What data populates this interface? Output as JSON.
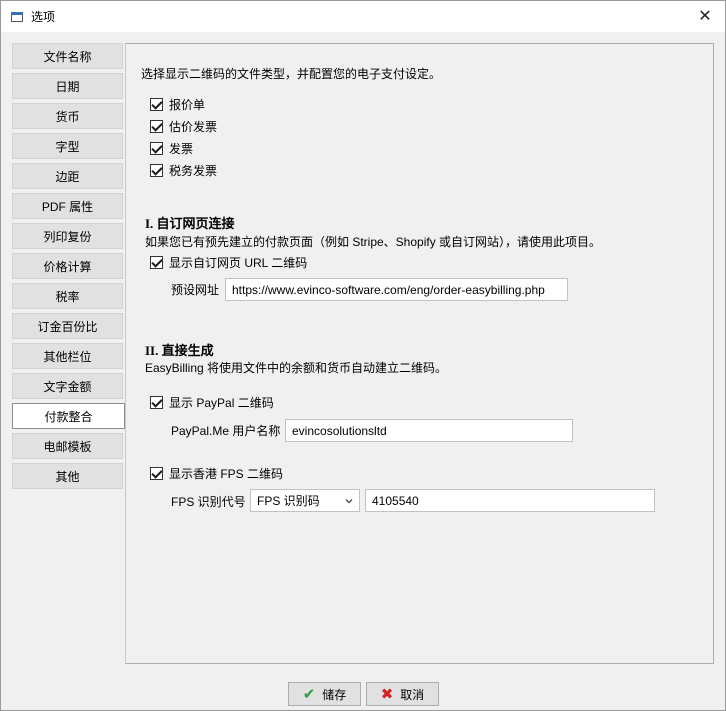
{
  "window": {
    "title": "选项",
    "close_icon": "close-icon"
  },
  "sidebar": {
    "items": [
      {
        "label": "文件名称",
        "active": false
      },
      {
        "label": "日期",
        "active": false
      },
      {
        "label": "货币",
        "active": false
      },
      {
        "label": "字型",
        "active": false
      },
      {
        "label": "边距",
        "active": false
      },
      {
        "label": "PDF 属性",
        "active": false
      },
      {
        "label": "列印复份",
        "active": false
      },
      {
        "label": "价格计算",
        "active": false
      },
      {
        "label": "税率",
        "active": false
      },
      {
        "label": "订金百份比",
        "active": false
      },
      {
        "label": "其他栏位",
        "active": false
      },
      {
        "label": "文字金额",
        "active": false
      },
      {
        "label": "付款整合",
        "active": true
      },
      {
        "label": "电邮模板",
        "active": false
      },
      {
        "label": "其他",
        "active": false
      }
    ]
  },
  "main": {
    "intro": "选择显示二维码的文件类型，并配置您的电子支付设定。",
    "doc_types": [
      {
        "label": "报价单",
        "checked": true
      },
      {
        "label": "估价发票",
        "checked": true
      },
      {
        "label": "发票",
        "checked": true
      },
      {
        "label": "税务发票",
        "checked": true
      }
    ],
    "section1": {
      "heading": "I. 自订网页连接",
      "description": "如果您已有预先建立的付款页面（例如 Stripe、Shopify 或自订网站），请使用此项目。",
      "checkbox_label": "显示自订网页 URL 二维码",
      "checked": true,
      "url_label": "预设网址",
      "url_value": "https://www.evinco-software.com/eng/order-easybilling.php"
    },
    "section2": {
      "heading": "II. 直接生成",
      "description": "EasyBilling 将使用文件中的余额和货币自动建立二维码。",
      "paypal": {
        "checkbox_label": "显示 PayPal 二维码",
        "checked": true,
        "field_label": "PayPal.Me 用户名称",
        "field_value": "evincosolutionsltd"
      },
      "fps": {
        "checkbox_label": "显示香港 FPS 二维码",
        "checked": true,
        "field_label": "FPS 识别代号",
        "select_value": "FPS 识别码",
        "field_value": "4105540"
      }
    }
  },
  "footer": {
    "save_label": "储存",
    "cancel_label": "取消",
    "save_icon": "check-icon",
    "cancel_icon": "cross-icon",
    "save_icon_color": "#2e9b3c",
    "cancel_icon_color": "#d42020"
  }
}
